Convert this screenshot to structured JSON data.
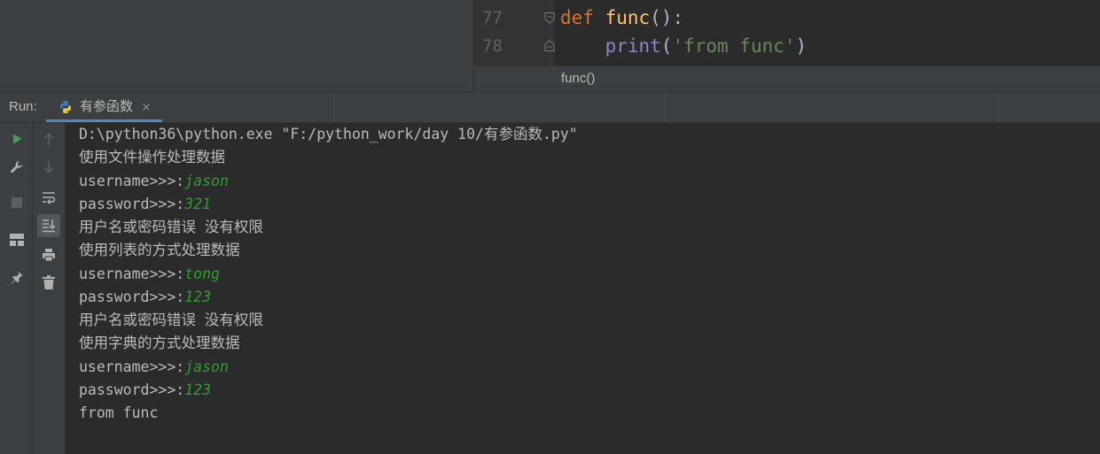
{
  "colors": {
    "panel_bg": "#3c3f41",
    "editor_bg": "#2b2b2b",
    "gutter_bg": "#313335",
    "text": "#bbbbbb",
    "line_number": "#606366",
    "keyword": "#cc7832",
    "function": "#ffc66d",
    "builtin": "#8888c6",
    "string": "#6a8759",
    "code_plain": "#a9b7c6",
    "console_input": "#2f9e2f",
    "tab_underline": "#4a88c7",
    "run_green": "#499c54"
  },
  "editor": {
    "lines": [
      {
        "number": "77",
        "fold_icon": "fold-start-icon",
        "tokens": [
          "def",
          " func",
          "():"
        ]
      },
      {
        "number": "78",
        "fold_icon": "fold-end-icon",
        "tokens": [
          "    print",
          "(",
          "'from func'",
          ")"
        ]
      }
    ],
    "breadcrumb": "func()"
  },
  "run_panel": {
    "label": "Run:",
    "tab": {
      "title": "有参函数",
      "icon": "python-icon",
      "close_icon": "close-icon",
      "selected": true
    }
  },
  "toolbar": {
    "left": [
      {
        "icon": "run-icon",
        "enabled": true
      },
      {
        "icon": "wrench-icon",
        "enabled": true
      },
      {
        "icon": "stop-icon",
        "enabled": false
      },
      {
        "icon": "layout-icon",
        "enabled": true
      },
      {
        "icon": "pin-icon",
        "enabled": true
      }
    ],
    "right": [
      {
        "icon": "up-arrow-icon",
        "enabled": false
      },
      {
        "icon": "down-arrow-icon",
        "enabled": false
      },
      {
        "icon": "soft-wrap-icon",
        "enabled": true
      },
      {
        "icon": "scroll-to-end-icon",
        "enabled": true,
        "toggled": true
      },
      {
        "icon": "print-icon",
        "enabled": true
      },
      {
        "icon": "trash-icon",
        "enabled": true
      }
    ]
  },
  "console": {
    "lines": [
      {
        "text": "D:\\python36\\python.exe \"F:/python_work/day 10/有参函数.py\""
      },
      {
        "text": "使用文件操作处理数据"
      },
      {
        "text": "username>>>:",
        "input": "jason"
      },
      {
        "text": "password>>>:",
        "input": "321"
      },
      {
        "text": "用户名或密码错误 没有权限"
      },
      {
        "text": "使用列表的方式处理数据"
      },
      {
        "text": "username>>>:",
        "input": "tong"
      },
      {
        "text": "password>>>:",
        "input": "123"
      },
      {
        "text": "用户名或密码错误 没有权限"
      },
      {
        "text": "使用字典的方式处理数据"
      },
      {
        "text": "username>>>:",
        "input": "jason"
      },
      {
        "text": "password>>>:",
        "input": "123"
      },
      {
        "text": "from func"
      }
    ]
  }
}
